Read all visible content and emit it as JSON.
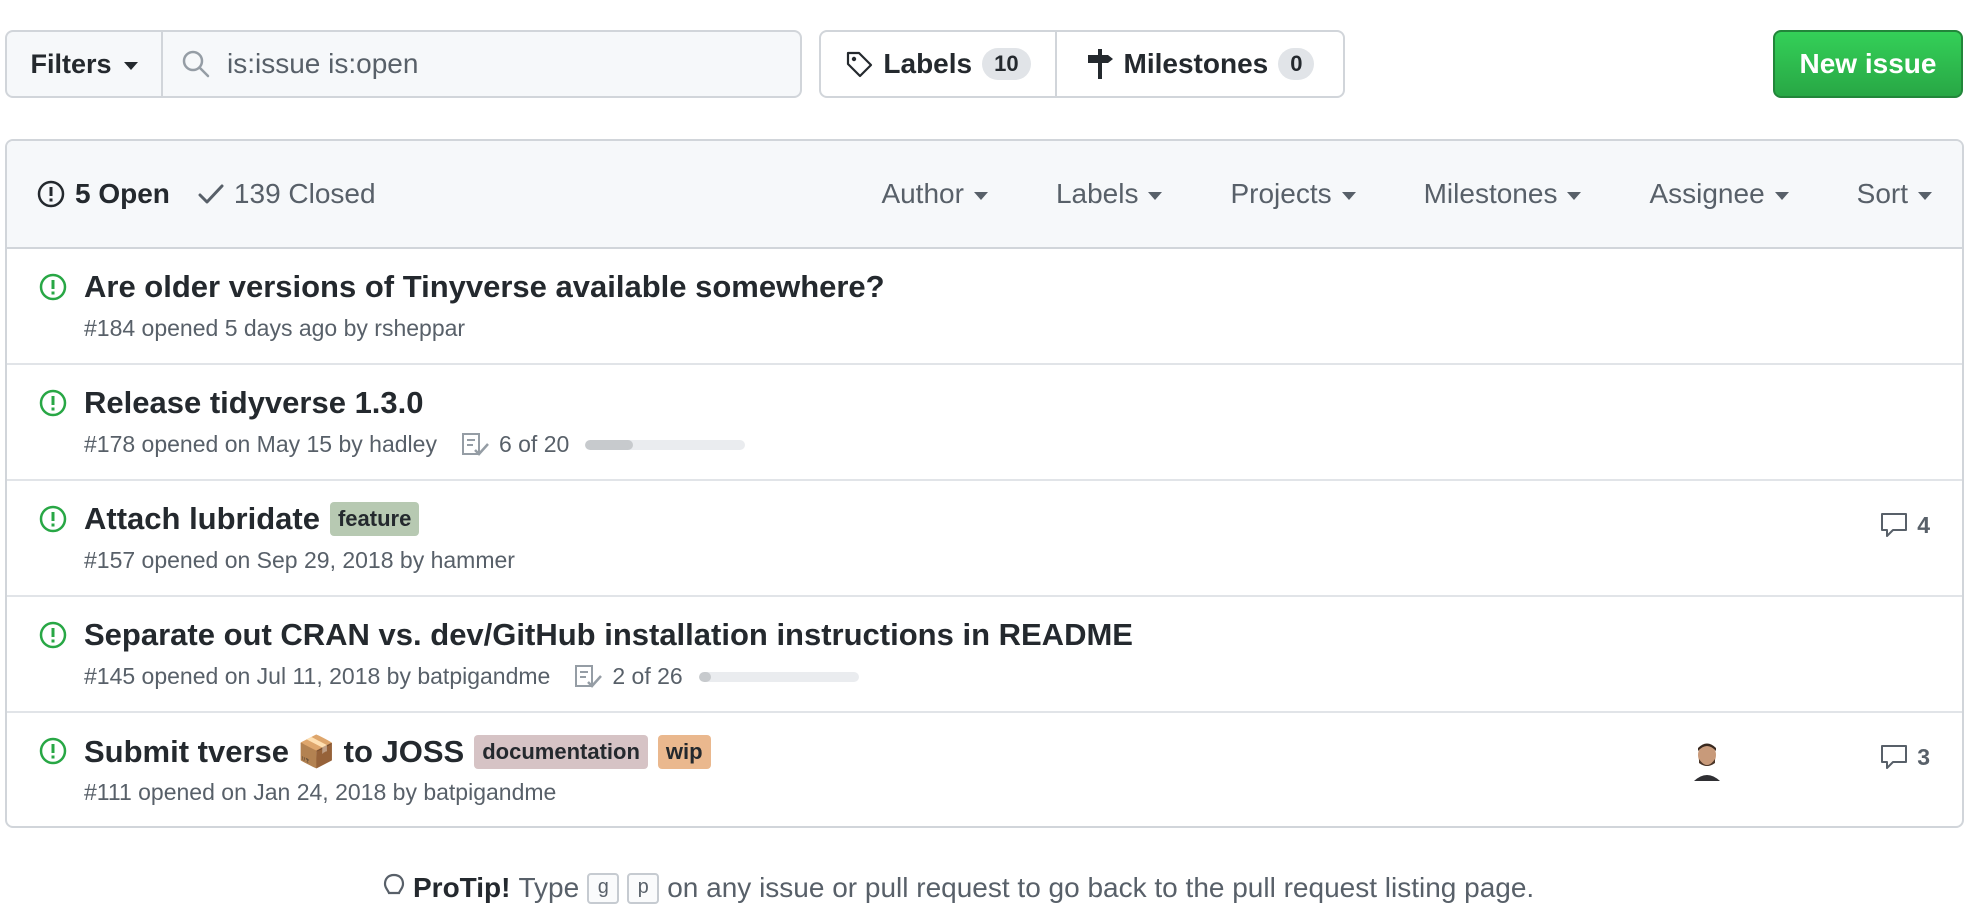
{
  "toolbar": {
    "filters_label": "Filters",
    "search_value": "is:issue is:open",
    "labels_label": "Labels",
    "labels_count": "10",
    "milestones_label": "Milestones",
    "milestones_count": "0",
    "new_issue_label": "New issue",
    "accent_green": "#2ea44f"
  },
  "header": {
    "open_label": "5 Open",
    "closed_label": "139 Closed",
    "filters": [
      "Author",
      "Labels",
      "Projects",
      "Milestones",
      "Assignee",
      "Sort"
    ]
  },
  "issues": [
    {
      "title": "Are older versions of Tinyverse available somewhere?",
      "meta": "#184 opened 5 days ago by rsheppar"
    },
    {
      "title": "Release tidyverse 1.3.0",
      "meta": "#178 opened on May 15 by hadley",
      "progress_text": "6 of 20",
      "progress": 0.3
    },
    {
      "title": "Attach lubridate",
      "meta": "#157 opened on Sep 29, 2018 by hammer",
      "labels": [
        {
          "name": "feature",
          "color": "#b7c9b2"
        }
      ],
      "comments": "4"
    },
    {
      "title": "Separate out CRAN vs. dev/GitHub installation instructions in README",
      "meta": "#145 opened on Jul 11, 2018 by batpigandme",
      "progress_text": "2 of 26",
      "progress": 0.077
    },
    {
      "title_pre": "Submit tverse",
      "title_emoji": "📦",
      "title_post": "to JOSS",
      "meta": "#111 opened on Jan 24, 2018 by batpigandme",
      "labels": [
        {
          "name": "documentation",
          "color": "#d6c3c5"
        },
        {
          "name": "wip",
          "color": "#eab88e"
        }
      ],
      "comments": "3"
    }
  ],
  "protip": {
    "icon": "lightbulb-icon",
    "strong": "ProTip!",
    "pre": "Type",
    "key1": "g",
    "key2": "p",
    "post": "on any issue or pull request to go back to the pull request listing page."
  }
}
